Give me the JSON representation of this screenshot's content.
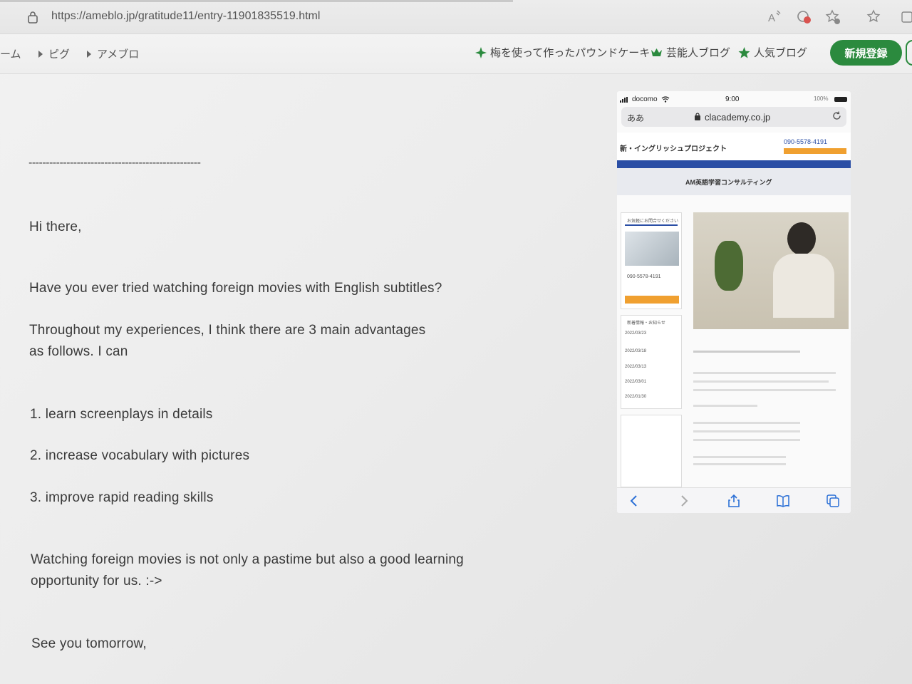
{
  "browser": {
    "url": "https://ameblo.jp/gratitude11/entry-11901835519.html"
  },
  "nav": {
    "home_partial": "ーム",
    "items": [
      "ピグ",
      "アメブロ"
    ],
    "links": [
      "梅を使って作ったパウンドケーキ",
      "芸能人ブログ",
      "人気ブログ"
    ],
    "signup_label": "新規登録"
  },
  "article": {
    "rule": "--------------------------------------------------",
    "greeting": "Hi there,",
    "question": "Have you ever tried watching foreign movies with English subtitles?",
    "intro_line1": "Throughout my experiences, I think there are 3 main advantages",
    "intro_line2": "as follows. I can",
    "list": [
      "1. learn screenplays in details",
      "2. increase vocabulary with pictures",
      "3. improve rapid reading skills"
    ],
    "closing_line1": "Watching foreign movies is not only a pastime but also a good learning",
    "closing_line2": "opportunity for us. :->",
    "signoff": "See you tomorrow,"
  },
  "phone": {
    "carrier": "docomo",
    "time": "9:00",
    "battery": "100%",
    "aa": "ああ",
    "domain": "clacademy.co.jp",
    "site_title": "新・イングリッシュプロジェクト",
    "phone_number": "090-5578-4191",
    "page_heading": "AM英語学習コンサルティング",
    "contact_heading": "お気軽にお問合せください",
    "contact_phone": "090-5578-4191",
    "news_heading": "新着情報・お知らせ",
    "news_dates": [
      "2022/03/23",
      "2022/03/18",
      "2022/03/13",
      "2022/03/01",
      "2022/01/30"
    ]
  },
  "colors": {
    "accent_green": "#2b8a3e",
    "phone_blue": "#2a4ea5",
    "phone_orange": "#f0a030"
  }
}
